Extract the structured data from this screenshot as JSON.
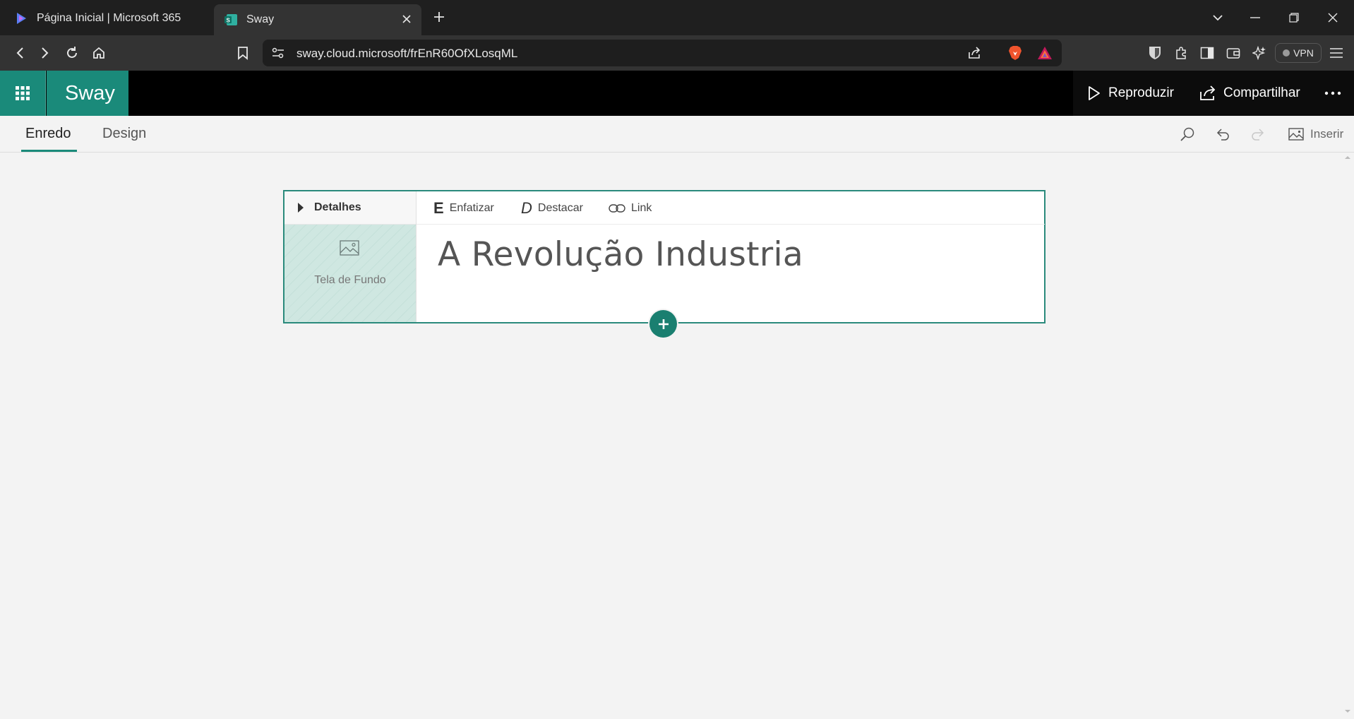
{
  "browser": {
    "tabs": [
      {
        "title": "Página Inicial | Microsoft 365",
        "active": false
      },
      {
        "title": "Sway",
        "active": true
      }
    ],
    "url": "sway.cloud.microsoft/frEnR60OfXLosqML",
    "vpn_label": "VPN"
  },
  "app": {
    "brand": "Sway",
    "play_label": "Reproduzir",
    "share_label": "Compartilhar",
    "accent_color": "#1a8a7a"
  },
  "ribbon": {
    "tabs": [
      {
        "label": "Enredo",
        "active": true
      },
      {
        "label": "Design",
        "active": false
      }
    ],
    "insert_label": "Inserir"
  },
  "card": {
    "details_label": "Detalhes",
    "background_label": "Tela de Fundo",
    "format_buttons": [
      {
        "glyph": "E",
        "label": "Enfatizar"
      },
      {
        "glyph": "D",
        "label": "Destacar"
      },
      {
        "glyph": "link-icon",
        "label": "Link"
      }
    ],
    "title": "A Revolução Industria"
  }
}
